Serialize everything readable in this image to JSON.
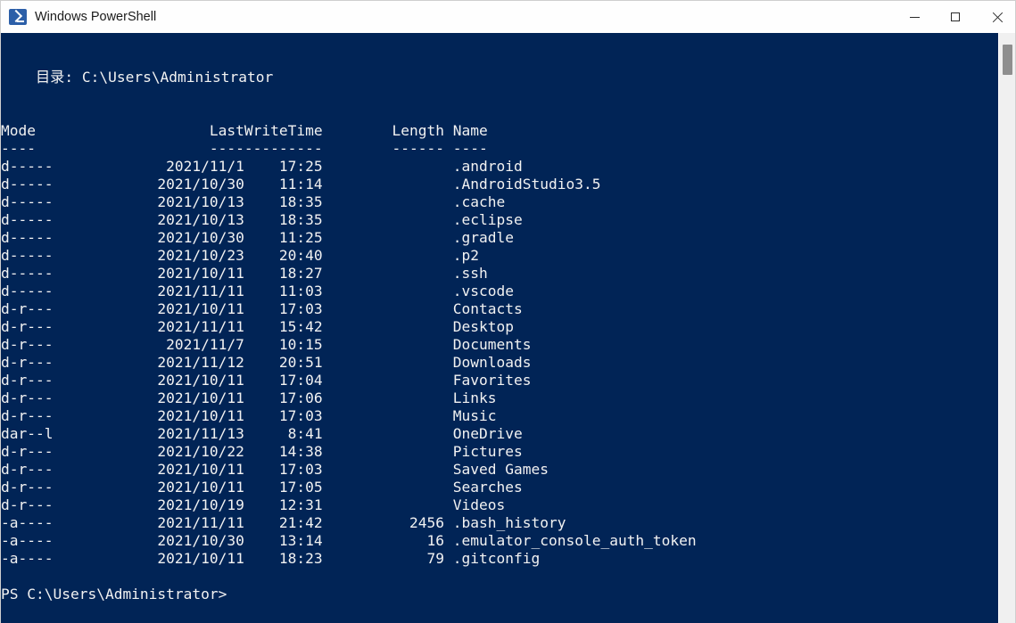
{
  "window": {
    "title": "Windows PowerShell",
    "icon": "powershell-icon",
    "colors": {
      "console_background": "#012456",
      "console_foreground": "#f2f2f2",
      "titlebar_background": "#fefefe",
      "scrollbar_track": "#f0f0f0",
      "scrollbar_thumb": "#8e8e8e"
    },
    "controls": [
      {
        "name": "minimize",
        "glyph": "minimize-icon"
      },
      {
        "name": "maximize",
        "glyph": "maximize-icon"
      },
      {
        "name": "close",
        "glyph": "close-icon"
      }
    ]
  },
  "console": {
    "directory_label": "目录: C:\\Users\\Administrator",
    "headers": {
      "mode": "Mode",
      "lastwritetime": "LastWriteTime",
      "length": "Length",
      "name": "Name"
    },
    "header_rules": {
      "mode": "----",
      "lastwritetime": "-------------",
      "length": "------",
      "name": "----"
    },
    "rows": [
      {
        "mode": "d-----",
        "date": "2021/11/1",
        "time": "17:25",
        "length": "",
        "name": ".android"
      },
      {
        "mode": "d-----",
        "date": "2021/10/30",
        "time": "11:14",
        "length": "",
        "name": ".AndroidStudio3.5"
      },
      {
        "mode": "d-----",
        "date": "2021/10/13",
        "time": "18:35",
        "length": "",
        "name": ".cache"
      },
      {
        "mode": "d-----",
        "date": "2021/10/13",
        "time": "18:35",
        "length": "",
        "name": ".eclipse"
      },
      {
        "mode": "d-----",
        "date": "2021/10/30",
        "time": "11:25",
        "length": "",
        "name": ".gradle"
      },
      {
        "mode": "d-----",
        "date": "2021/10/23",
        "time": "20:40",
        "length": "",
        "name": ".p2"
      },
      {
        "mode": "d-----",
        "date": "2021/10/11",
        "time": "18:27",
        "length": "",
        "name": ".ssh"
      },
      {
        "mode": "d-----",
        "date": "2021/11/11",
        "time": "11:03",
        "length": "",
        "name": ".vscode"
      },
      {
        "mode": "d-r---",
        "date": "2021/10/11",
        "time": "17:03",
        "length": "",
        "name": "Contacts"
      },
      {
        "mode": "d-r---",
        "date": "2021/11/11",
        "time": "15:42",
        "length": "",
        "name": "Desktop"
      },
      {
        "mode": "d-r---",
        "date": "2021/11/7",
        "time": "10:15",
        "length": "",
        "name": "Documents"
      },
      {
        "mode": "d-r---",
        "date": "2021/11/12",
        "time": "20:51",
        "length": "",
        "name": "Downloads"
      },
      {
        "mode": "d-r---",
        "date": "2021/10/11",
        "time": "17:04",
        "length": "",
        "name": "Favorites"
      },
      {
        "mode": "d-r---",
        "date": "2021/10/11",
        "time": "17:06",
        "length": "",
        "name": "Links"
      },
      {
        "mode": "d-r---",
        "date": "2021/10/11",
        "time": "17:03",
        "length": "",
        "name": "Music"
      },
      {
        "mode": "dar--l",
        "date": "2021/11/13",
        "time": "8:41",
        "length": "",
        "name": "OneDrive"
      },
      {
        "mode": "d-r---",
        "date": "2021/10/22",
        "time": "14:38",
        "length": "",
        "name": "Pictures"
      },
      {
        "mode": "d-r---",
        "date": "2021/10/11",
        "time": "17:03",
        "length": "",
        "name": "Saved Games"
      },
      {
        "mode": "d-r---",
        "date": "2021/10/11",
        "time": "17:05",
        "length": "",
        "name": "Searches"
      },
      {
        "mode": "d-r---",
        "date": "2021/10/19",
        "time": "12:31",
        "length": "",
        "name": "Videos"
      },
      {
        "mode": "-a----",
        "date": "2021/11/11",
        "time": "21:42",
        "length": "2456",
        "name": ".bash_history"
      },
      {
        "mode": "-a----",
        "date": "2021/10/30",
        "time": "13:14",
        "length": "16",
        "name": ".emulator_console_auth_token"
      },
      {
        "mode": "-a----",
        "date": "2021/10/11",
        "time": "18:23",
        "length": "79",
        "name": ".gitconfig"
      }
    ],
    "prompt": "PS C:\\Users\\Administrator>"
  }
}
